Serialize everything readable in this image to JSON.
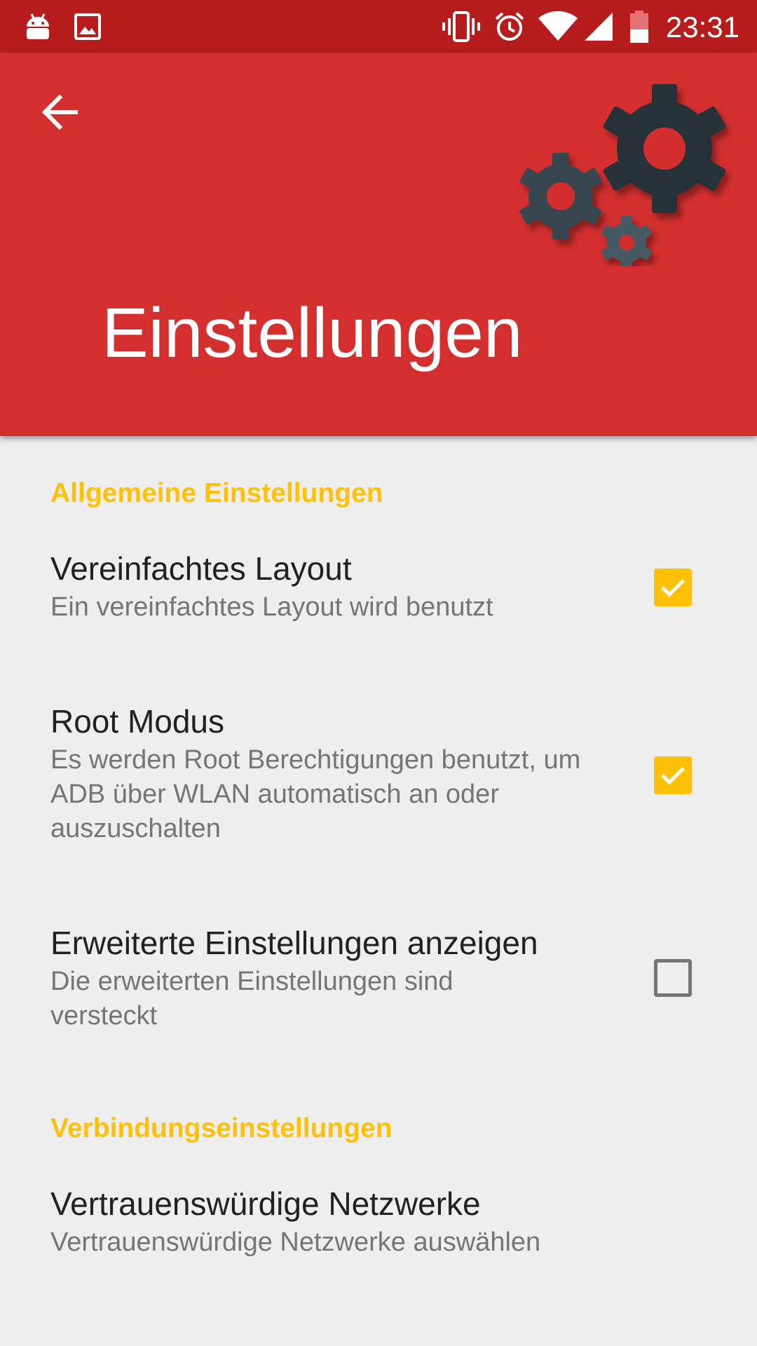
{
  "status_bar": {
    "time": "23:31",
    "left_icons": [
      "android-icon",
      "image-icon"
    ],
    "right_icons": [
      "vibrate-icon",
      "alarm-icon",
      "wifi-icon",
      "signal-icon",
      "battery-icon"
    ]
  },
  "header": {
    "title": "Einstellungen",
    "back_icon": "arrow-back-icon",
    "illustration": "gears-icon",
    "background_color": "#d32f2f",
    "status_bar_color": "#b71c1c"
  },
  "accent_color": "#ffc107",
  "sections": [
    {
      "category": "Allgemeine Einstellungen",
      "items": [
        {
          "title": "Vereinfachtes Layout",
          "summary": "Ein vereinfachtes Layout wird benutzt",
          "checked": true
        },
        {
          "title": "Root Modus",
          "summary": "Es werden Root Berechtigungen benutzt, um ADB über WLAN automatisch an oder auszuschalten",
          "checked": true
        },
        {
          "title": "Erweiterte Einstellungen anzeigen",
          "summary": "Die erweiterten Einstellungen sind versteckt",
          "checked": false
        }
      ]
    },
    {
      "category": "Verbindungseinstellungen",
      "items": [
        {
          "title": "Vertrauenswürdige Netzwerke",
          "summary": "Vertrauenswürdige Netzwerke auswählen"
        }
      ]
    }
  ]
}
